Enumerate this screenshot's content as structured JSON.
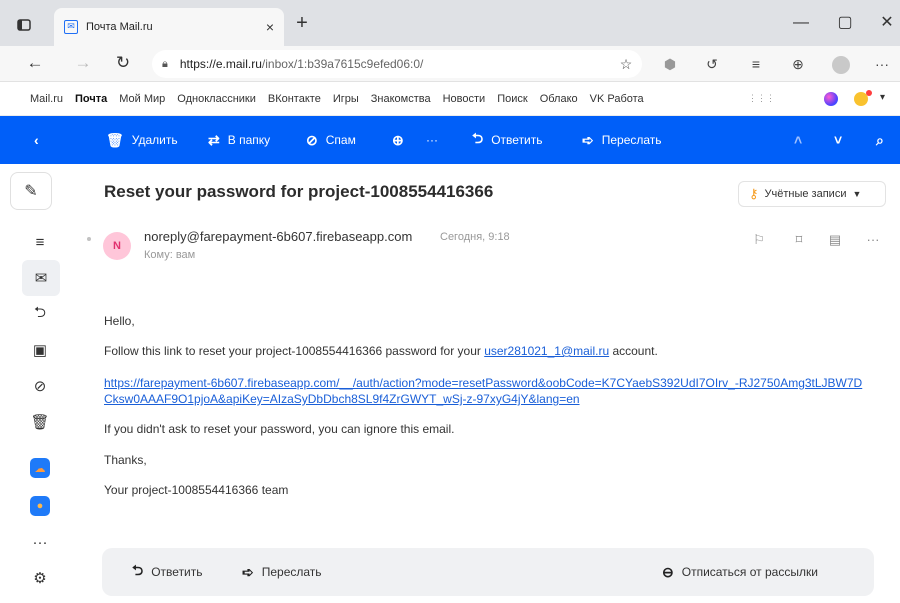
{
  "browser": {
    "tab_title": "Почта Mail.ru",
    "tab_close": "×",
    "new_tab": "+",
    "win_min": "—",
    "win_max": "▢",
    "win_close": "✕",
    "url_host": "https://e.mail.ru",
    "url_path": "/inbox/1:b39a7615c9efed06:0/"
  },
  "portal_links": [
    "Mail.ru",
    "Почта",
    "Мой Мир",
    "Одноклассники",
    "ВКонтакте",
    "Игры",
    "Знакомства",
    "Новости",
    "Поиск",
    "Облако",
    "VK Работа"
  ],
  "toolbar": {
    "delete": "Удалить",
    "to_folder": "В папку",
    "spam": "Спам",
    "more": "···",
    "reply": "Ответить",
    "forward": "Переслать"
  },
  "message": {
    "subject": "Reset your password for project-1008554416366",
    "accounts_label": "Учётные записи",
    "sender_initial": "N",
    "sender_email": "noreply@farepayment-6b607.firebaseapp.com",
    "date": "Сегодня, 9:18",
    "to": "Кому: вам",
    "more_dots": "···"
  },
  "body": {
    "greeting": "Hello,",
    "line1_before": "Follow this link to reset your project-1008554416366 password for your ",
    "line1_link": "user281021_1@mail.ru",
    "line1_after": " account.",
    "reset_url": "https://farepayment-6b607.firebaseapp.com/__/auth/action?mode=resetPassword&oobCode=K7CYaebS392UdI7OIrv_-RJ2750Amg3tLJBW7DCksw0AAAF9O1pjoA&apiKey=AIzaSyDbDbch8SL9f4ZrGWYT_wSj-z-97xyG4jY&lang=en",
    "ignore": "If you didn't ask to reset your password, you can ignore this email.",
    "thanks": "Thanks,",
    "team": "Your project-1008554416366 team"
  },
  "footer": {
    "reply": "Ответить",
    "forward": "Переслать",
    "unsubscribe": "Отписаться от рассылки"
  },
  "colors": {
    "toolbar_blue": "#005ff9",
    "link_blue": "#1a5fd8",
    "sender_avatar_bg": "#ffc6d9"
  }
}
